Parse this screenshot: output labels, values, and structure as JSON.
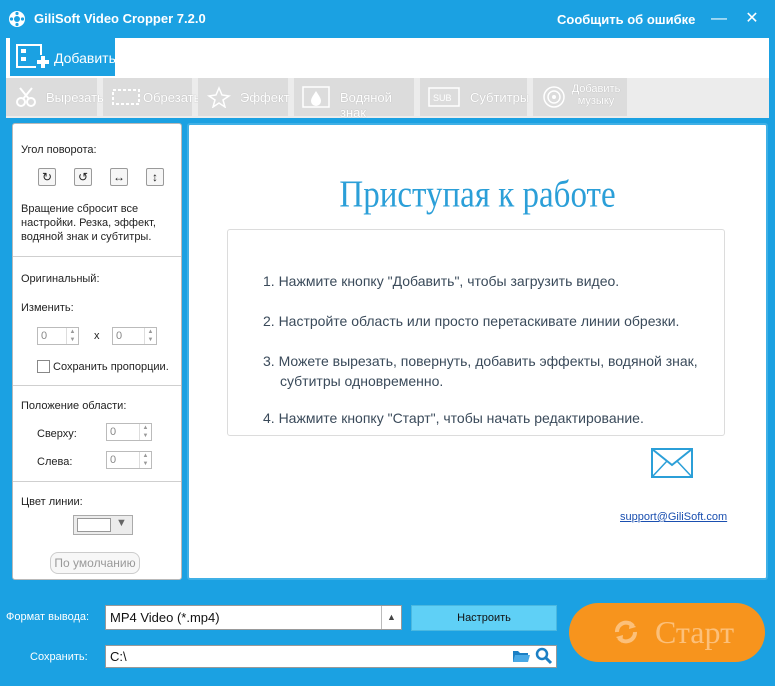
{
  "window": {
    "title": "GiliSoft Video Cropper 7.2.0",
    "report_link": "Сообщить об ошибке",
    "minimize": "—",
    "close": "✕"
  },
  "toolbar": {
    "add_label": "Добавить"
  },
  "tabs": [
    {
      "label": "Вырезать",
      "icon": "scissors-icon"
    },
    {
      "label": "Обрезать",
      "icon": "crop-icon"
    },
    {
      "label": "Эффект",
      "icon": "effect-icon"
    },
    {
      "label": "Водяной знак",
      "icon": "watermark-icon"
    },
    {
      "label": "Субтитры",
      "icon": "subtitle-icon"
    },
    {
      "label": "Добавить музыку",
      "icon": "music-icon"
    }
  ],
  "left_panel": {
    "rotation_label": "Угол поворота:",
    "rotation_note": "Вращение сбросит все настройки. Резка, эффект, водяной знак и субтитры.",
    "original_label": "Оригинальный:",
    "resize_label": "Изменить:",
    "width_value": "0",
    "x_sep": "x",
    "height_value": "0",
    "keep_ratio_label": "Сохранить пропорции.",
    "area_position_label": "Положение области:",
    "top_label": "Сверху:",
    "top_value": "0",
    "left_label": "Слева:",
    "left_value": "0",
    "line_color_label": "Цвет линии:",
    "default_button": "По умолчанию"
  },
  "main": {
    "heading": "Приступая к работе",
    "steps": [
      "1. Нажмите кнопку \"Добавить\", чтобы загрузить видео.",
      "2. Настройте область или просто перетаскивате линии обрезки.",
      "3. Можете вырезать, повернуть, добавить эффекты, водяной знак,",
      "субтитры одновременно.",
      "4. Нажмите кнопку \"Старт\", чтобы начать редактирование."
    ],
    "support_email": "support@GiliSoft.com"
  },
  "bottom": {
    "format_label": "Формат вывода:",
    "format_value": "MP4 Video (*.mp4)",
    "settings_button": "Настроить",
    "save_label": "Сохранить:",
    "save_path": "C:\\",
    "start_button": "Старт"
  },
  "colors": {
    "accent": "#1ba1e2",
    "start": "#f7941d",
    "heading": "#2b9fd8"
  }
}
